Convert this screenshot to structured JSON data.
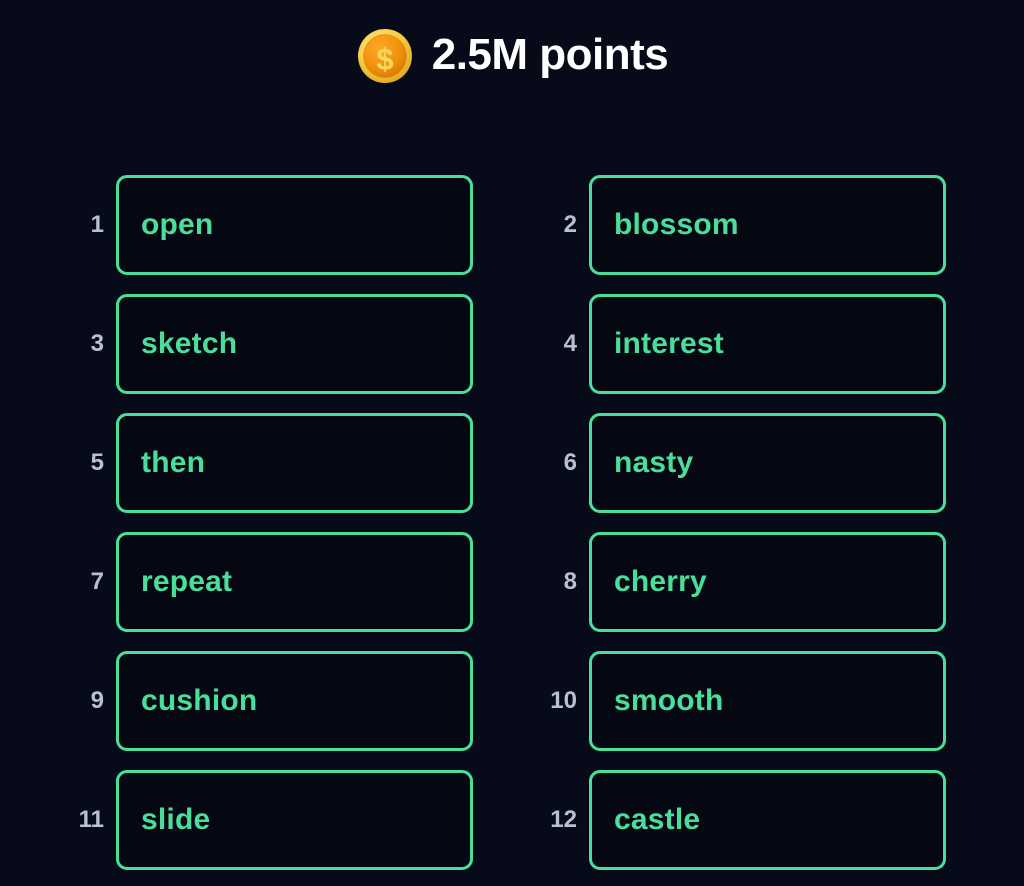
{
  "header": {
    "coin_icon": "gold-coin-dollar-icon",
    "points_label": "2.5M points",
    "points_value": "2.5M",
    "colors": {
      "background": "#070a18",
      "title_text": "#ffffff",
      "coin_outer": "#f7ce46",
      "coin_inner": "#f0920e",
      "coin_symbol": "#fbd85d"
    }
  },
  "word_list": {
    "accent_color": "#4ade9b",
    "number_color": "#b9c0cf",
    "card_background": "#050812",
    "columns": 2,
    "rows": 6,
    "count": 12,
    "items": [
      {
        "number": "1",
        "word": "open"
      },
      {
        "number": "2",
        "word": "blossom"
      },
      {
        "number": "3",
        "word": "sketch"
      },
      {
        "number": "4",
        "word": "interest"
      },
      {
        "number": "5",
        "word": "then"
      },
      {
        "number": "6",
        "word": "nasty"
      },
      {
        "number": "7",
        "word": "repeat"
      },
      {
        "number": "8",
        "word": "cherry"
      },
      {
        "number": "9",
        "word": "cushion"
      },
      {
        "number": "10",
        "word": "smooth"
      },
      {
        "number": "11",
        "word": "slide"
      },
      {
        "number": "12",
        "word": "castle"
      }
    ]
  }
}
